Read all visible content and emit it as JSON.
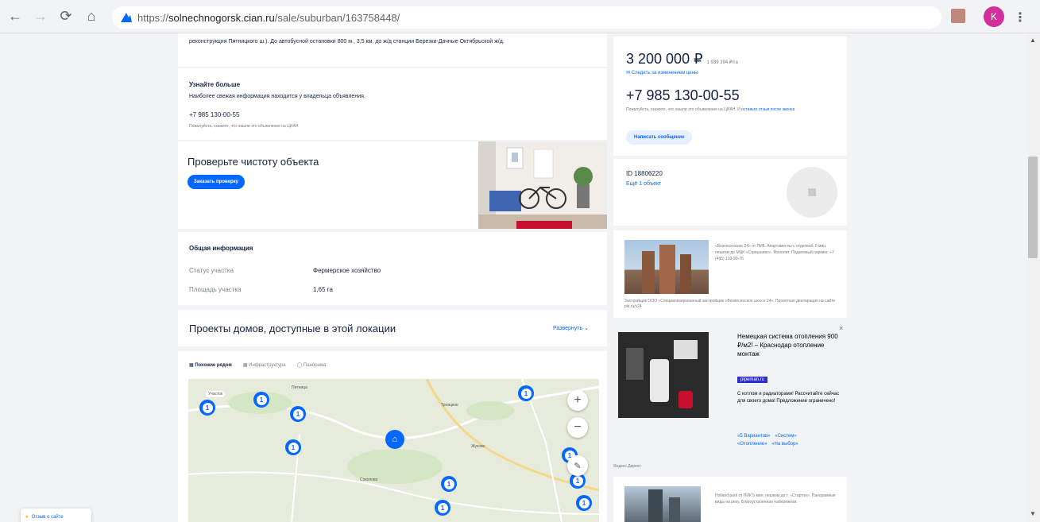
{
  "browser": {
    "url_scheme": "https://",
    "url_host": "solnechnogorsk.cian.ru",
    "url_path": "/sale/suburban/163758448/",
    "profile_initial": "K"
  },
  "listing": {
    "description_tail": "реконструкция Пятницкого ш.). До автобусной остановки 800 м., 3,5 км. до ж/д станции Березки-Дачные Октябрьской ж/д.",
    "learn_more": {
      "title": "Узнайте больше",
      "text": "Наиболее свежая информация находится у владельца объявления.",
      "phone": "+7 985 130-00-55",
      "note": "Пожалуйста, скажите, что нашли это объявление на ЦИАН"
    },
    "check": {
      "title": "Проверьте чистоту объекта",
      "button": "Заказать проверку"
    },
    "general_info": {
      "title": "Общая информация",
      "rows": [
        {
          "label": "Статус участка",
          "value": "Фермерское хозяйство"
        },
        {
          "label": "Площадь участка",
          "value": "1,65 га"
        }
      ]
    },
    "projects": {
      "title": "Проекты домов, доступные в этой локации",
      "expand": "Развернуть"
    },
    "map_tabs": [
      "Похожие рядом",
      "Инфраструктура",
      "Панорама"
    ],
    "map_labels": {
      "plot": "Участок",
      "place1": "Пятница",
      "place2": "Троицкое",
      "place3": "Жуково",
      "place4": "Соколово"
    },
    "map_marker_count": "1"
  },
  "sidebar": {
    "price": "3 200 000 ₽",
    "price_per_unit": "1 939 394 ₽/га",
    "price_follow": "Следить за изменением цены",
    "phone": "+7 985 130-00-55",
    "phone_note": "Пожалуйста, скажите, что нашли это объявление на ЦИАН. И",
    "phone_note_link": "оставьте отзыв после звонка",
    "write_button": "Написать сообщение",
    "agent_id": "ID 18806220",
    "agent_more": "Ещё 1 объект"
  },
  "ads": {
    "ad1": {
      "text": "«Вознесенское 24» от ПИК. Апартаменты с отделкой, 5 мин. пешком до МЦК «Стрешнево». Монолит. Подземный паркинг. +7 (495) 133-99-75",
      "footer": "Застройщик ООО «Специализированный застройщик «Вознесенское шоссе 24». Проектная декларация на сайте pik.ru/v24"
    },
    "ad2": {
      "title": "Немецкая система отопления 900 ₽/м2! – Краснодар отопление монтаж",
      "domain": "pipeman.ru",
      "text": "С котлом и радиаторами! Рассчитайте сейчас для своего дома! Предложение ограничено!",
      "links": [
        "«5 Вариантов»",
        "«Систем»",
        "«Отопление»",
        "«На выбор»"
      ],
      "source": "Яндекс.Директ",
      "close": "×"
    },
    "ad3": {
      "text": "Holland park от ПИК 5 мин. пешком до т. «Стартон». Панорамные виды на реку. Благоустроенная набережная."
    }
  },
  "feedback": "Отзыв о сайте",
  "colors": {
    "accent": "#0468ff",
    "text": "#152242",
    "bg": "#f1f3f5"
  }
}
